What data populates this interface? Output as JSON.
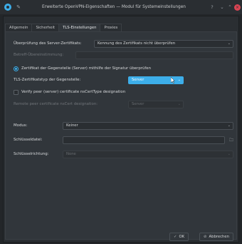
{
  "window": {
    "title": "Erweiterte OpenVPN-Eigenschaften — Modul für Systemeinstellungen",
    "help_glyph": "?",
    "min_glyph": "⌄",
    "max_glyph": "⌃",
    "close_glyph": "×",
    "pin_glyph": "✎"
  },
  "tabs": [
    {
      "label": "Allgemein"
    },
    {
      "label": "Sicherheit"
    },
    {
      "label": "TLS-Einstellungen"
    },
    {
      "label": "Proxies"
    }
  ],
  "active_tab": "TLS-Einstellungen",
  "form": {
    "server_cert_check": {
      "label": "Überprüfung des Server-Zertifikats:",
      "value": "Kennung des Zertifikats nicht überprüfen"
    },
    "subject_match": {
      "label": "Betreff-Übereinstimmung:",
      "value": ""
    },
    "verify_peer_radio": {
      "label": "Zertifikat der Gegenstelle (Server) mithilfe der Signatur überprüfen",
      "checked": true
    },
    "peer_cert_type": {
      "label": "TLS-Zertifikatstyp der Gegenstelle:",
      "value": "Server"
    },
    "verify_peer_designation": {
      "label": "Verify peer (server) certificate nsCertType designation",
      "checked": false
    },
    "ns_cert_type": {
      "label": "Remote peer certificate nsCert designation:",
      "value": "Server"
    },
    "mode": {
      "label": "Modus:",
      "value": "Keiner"
    },
    "key_file": {
      "label": "Schlüsseldatei:",
      "value": ""
    },
    "key_direction": {
      "label": "Schlüsselrichtung:",
      "value": "None"
    }
  },
  "footer": {
    "ok_label": "OK",
    "ok_icon": "✓",
    "cancel_label": "Abbrechen",
    "cancel_icon": "⊘"
  },
  "colors": {
    "accent": "#3daee9",
    "background": "#31363b",
    "close_button": "#da4453"
  }
}
